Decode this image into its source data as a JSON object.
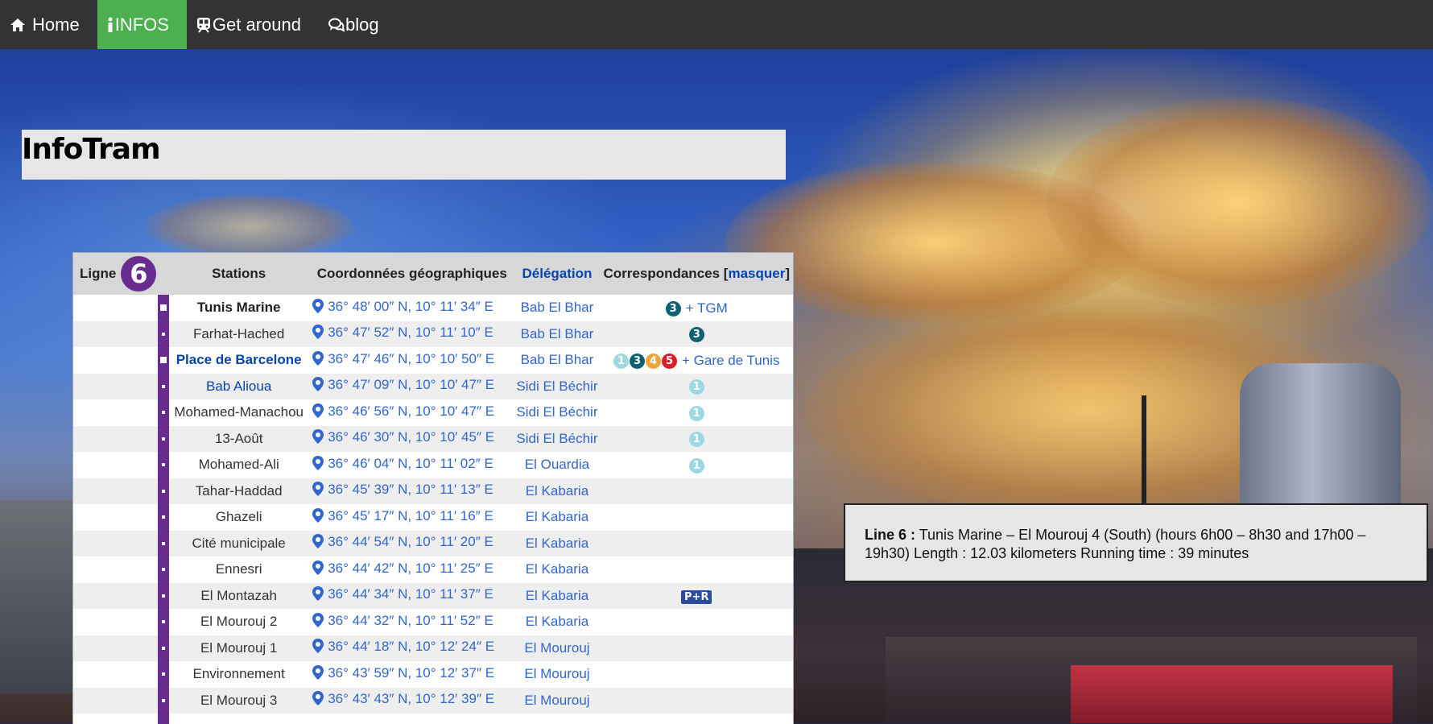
{
  "nav": {
    "items": [
      {
        "label": "Home",
        "icon": "home-icon"
      },
      {
        "label": "INFOS",
        "icon": "info-icon"
      },
      {
        "label": "Get around",
        "icon": "train-icon"
      },
      {
        "label": "blog",
        "icon": "comments-icon"
      }
    ],
    "active_color": "#4caf50",
    "bar_color": "#333333"
  },
  "page": {
    "title": "InfoTram"
  },
  "table": {
    "headers": {
      "ligne": "Ligne",
      "line_number": "6",
      "stations": "Stations",
      "coords": "Coordonnées géographiques",
      "delegation": "Délégation",
      "corr_prefix": "Correspondances [",
      "corr_link": "masquer",
      "corr_suffix": "]"
    },
    "line_color": "#6a2c91",
    "rows": [
      {
        "station": "Tunis Marine",
        "coord": "36° 48′ 00″ N, 10° 11′ 34″ E",
        "delegation": "Bab El Bhar",
        "corr_lines": [
          "3"
        ],
        "corr_text": "+ TGM"
      },
      {
        "station": "Farhat-Hached",
        "coord": "36° 47′ 52″ N, 10° 11′ 10″ E",
        "delegation": "Bab El Bhar",
        "corr_lines": [
          "3"
        ],
        "corr_text": ""
      },
      {
        "station": "Place de Barcelone",
        "coord": "36° 47′ 46″ N, 10° 10′ 50″ E",
        "delegation": "Bab El Bhar",
        "corr_lines": [
          "1",
          "3",
          "4",
          "5"
        ],
        "corr_text": "+ Gare de Tunis"
      },
      {
        "station": "Bab Alioua",
        "coord": "36° 47′ 09″ N, 10° 10′ 47″ E",
        "delegation": "Sidi El Béchir",
        "corr_lines": [
          "1"
        ],
        "corr_text": ""
      },
      {
        "station": "Mohamed-Manachou",
        "coord": "36° 46′ 56″ N, 10° 10′ 47″ E",
        "delegation": "Sidi El Béchir",
        "corr_lines": [
          "1"
        ],
        "corr_text": ""
      },
      {
        "station": "13-Août",
        "coord": "36° 46′ 30″ N, 10° 10′ 45″ E",
        "delegation": "Sidi El Béchir",
        "corr_lines": [
          "1"
        ],
        "corr_text": ""
      },
      {
        "station": "Mohamed-Ali",
        "coord": "36° 46′ 04″ N, 10° 11′ 02″ E",
        "delegation": "El Ouardia",
        "corr_lines": [
          "1"
        ],
        "corr_text": ""
      },
      {
        "station": "Tahar-Haddad",
        "coord": "36° 45′ 39″ N, 10° 11′ 13″ E",
        "delegation": "El Kabaria",
        "corr_lines": [],
        "corr_text": ""
      },
      {
        "station": "Ghazeli",
        "coord": "36° 45′ 17″ N, 10° 11′ 16″ E",
        "delegation": "El Kabaria",
        "corr_lines": [],
        "corr_text": ""
      },
      {
        "station": "Cité municipale",
        "coord": "36° 44′ 54″ N, 10° 11′ 20″ E",
        "delegation": "El Kabaria",
        "corr_lines": [],
        "corr_text": ""
      },
      {
        "station": "Ennesri",
        "coord": "36° 44′ 42″ N, 10° 11′ 25″ E",
        "delegation": "El Kabaria",
        "corr_lines": [],
        "corr_text": ""
      },
      {
        "station": "El Montazah",
        "coord": "36° 44′ 34″ N, 10° 11′ 37″ E",
        "delegation": "El Kabaria",
        "corr_lines": [],
        "corr_text": "",
        "corr_badge": "P+R"
      },
      {
        "station": "El Mourouj 2",
        "coord": "36° 44′ 32″ N, 10° 11′ 52″ E",
        "delegation": "El Kabaria",
        "corr_lines": [],
        "corr_text": ""
      },
      {
        "station": "El Mourouj 1",
        "coord": "36° 44′ 18″ N, 10° 12′ 24″ E",
        "delegation": "El Mourouj",
        "corr_lines": [],
        "corr_text": ""
      },
      {
        "station": "Environnement",
        "coord": "36° 43′ 59″ N, 10° 12′ 37″ E",
        "delegation": "El Mourouj",
        "corr_lines": [],
        "corr_text": ""
      },
      {
        "station": "El Mourouj 3",
        "coord": "36° 43′ 43″ N, 10° 12′ 39″ E",
        "delegation": "El Mourouj",
        "corr_lines": [],
        "corr_text": ""
      }
    ]
  },
  "info": {
    "label": "Line 6 :",
    "text": "Tunis Marine – El Mourouj 4 (South) (hours 6h00 – 8h30 and 17h00 – 19h30) Length : 12.03 kilometers Running time : 39 minutes"
  }
}
